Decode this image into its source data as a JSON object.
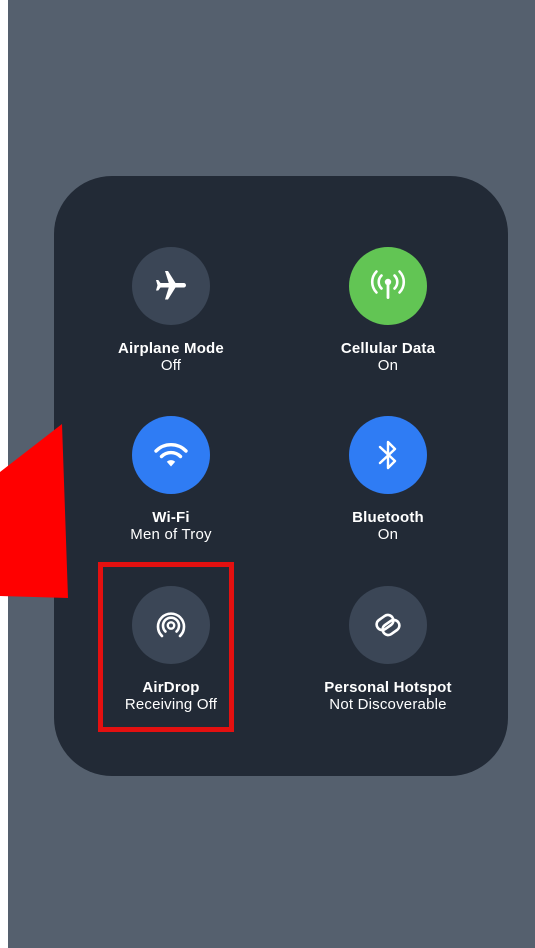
{
  "control_center": {
    "toggles": [
      {
        "label": "Airplane Mode",
        "status": "Off",
        "icon": "airplane-icon",
        "state": "off"
      },
      {
        "label": "Cellular Data",
        "status": "On",
        "icon": "cellular-antenna-icon",
        "state": "on",
        "color": "#62c554"
      },
      {
        "label": "Wi-Fi",
        "status": "Men of Troy",
        "icon": "wifi-icon",
        "state": "on",
        "color": "#2f7cf4"
      },
      {
        "label": "Bluetooth",
        "status": "On",
        "icon": "bluetooth-icon",
        "state": "on",
        "color": "#2f7cf4"
      },
      {
        "label": "AirDrop",
        "status": "Receiving Off",
        "icon": "airdrop-icon",
        "state": "off"
      },
      {
        "label": "Personal Hotspot",
        "status": "Not Discoverable",
        "icon": "hotspot-link-icon",
        "state": "off"
      }
    ]
  },
  "annotation": {
    "highlight_color": "#e41010",
    "highlighted_item": "AirDrop",
    "pointer_icon": "red-arrow-icon"
  }
}
